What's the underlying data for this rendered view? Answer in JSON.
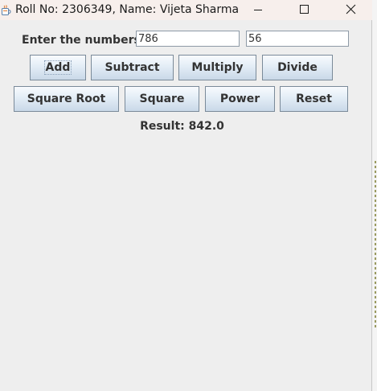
{
  "window": {
    "title": "Roll No: 2306349, Name: Vijeta Sharma",
    "icon": "java-app-icon"
  },
  "controls": {
    "minimize_icon": "minimize-icon",
    "maximize_icon": "maximize-icon",
    "close_icon": "close-icon"
  },
  "form": {
    "label": "Enter the numbers:",
    "first_number": "786",
    "second_number": "56"
  },
  "buttons": {
    "add": "Add",
    "subtract": "Subtract",
    "multiply": "Multiply",
    "divide": "Divide",
    "square_root": "Square Root",
    "square": "Square",
    "power": "Power",
    "reset": "Reset"
  },
  "result": {
    "text": "Result: 842.0"
  },
  "colors": {
    "window_bg": "#eeeeee",
    "titlebar_bg": "#f7efec",
    "button_border": "#7a8a99",
    "text": "#333333"
  }
}
